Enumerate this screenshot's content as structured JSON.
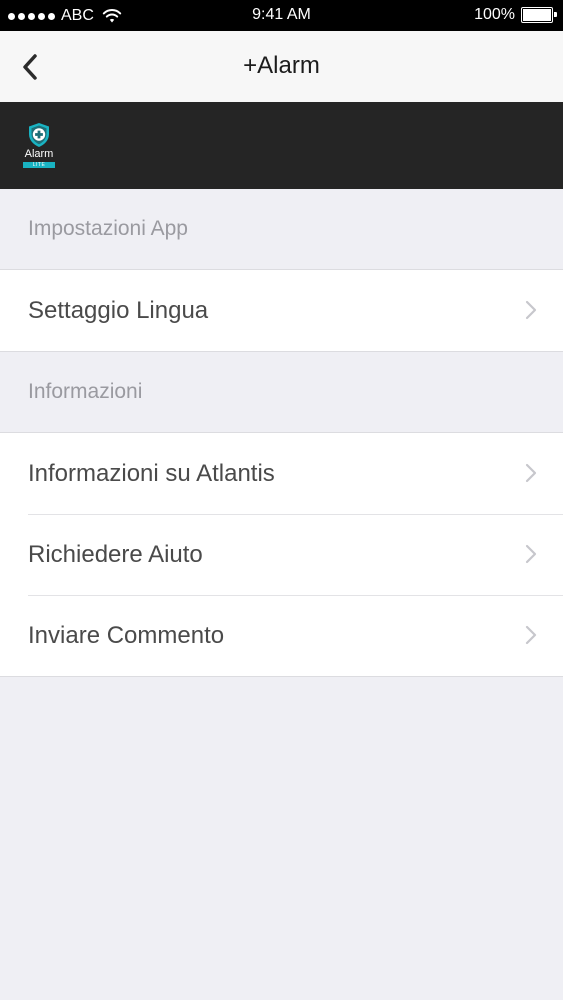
{
  "status_bar": {
    "carrier": "ABC",
    "time": "9:41 AM",
    "battery": "100%",
    "battery_level": 1.0,
    "icons": [
      "signal-dots",
      "wifi-icon",
      "battery-icon"
    ]
  },
  "nav": {
    "title": "+Alarm",
    "back_icon": "chevron-left-icon"
  },
  "brand": {
    "logo_text": "Alarm",
    "logo_tag": "LITE",
    "accent": "#19b3c2",
    "background": "#252525"
  },
  "sections": [
    {
      "header": "Impostazioni App",
      "items": [
        {
          "label": "Settaggio Lingua"
        }
      ]
    },
    {
      "header": "Informazioni",
      "items": [
        {
          "label": "Informazioni su Atlantis"
        },
        {
          "label": "Richiedere Aiuto"
        },
        {
          "label": "Inviare Commento"
        }
      ]
    }
  ],
  "colors": {
    "background": "#efeff4",
    "header_text": "#9a9aa0",
    "row_text": "#4a4a4a",
    "chevron": "#c7c7cc"
  }
}
